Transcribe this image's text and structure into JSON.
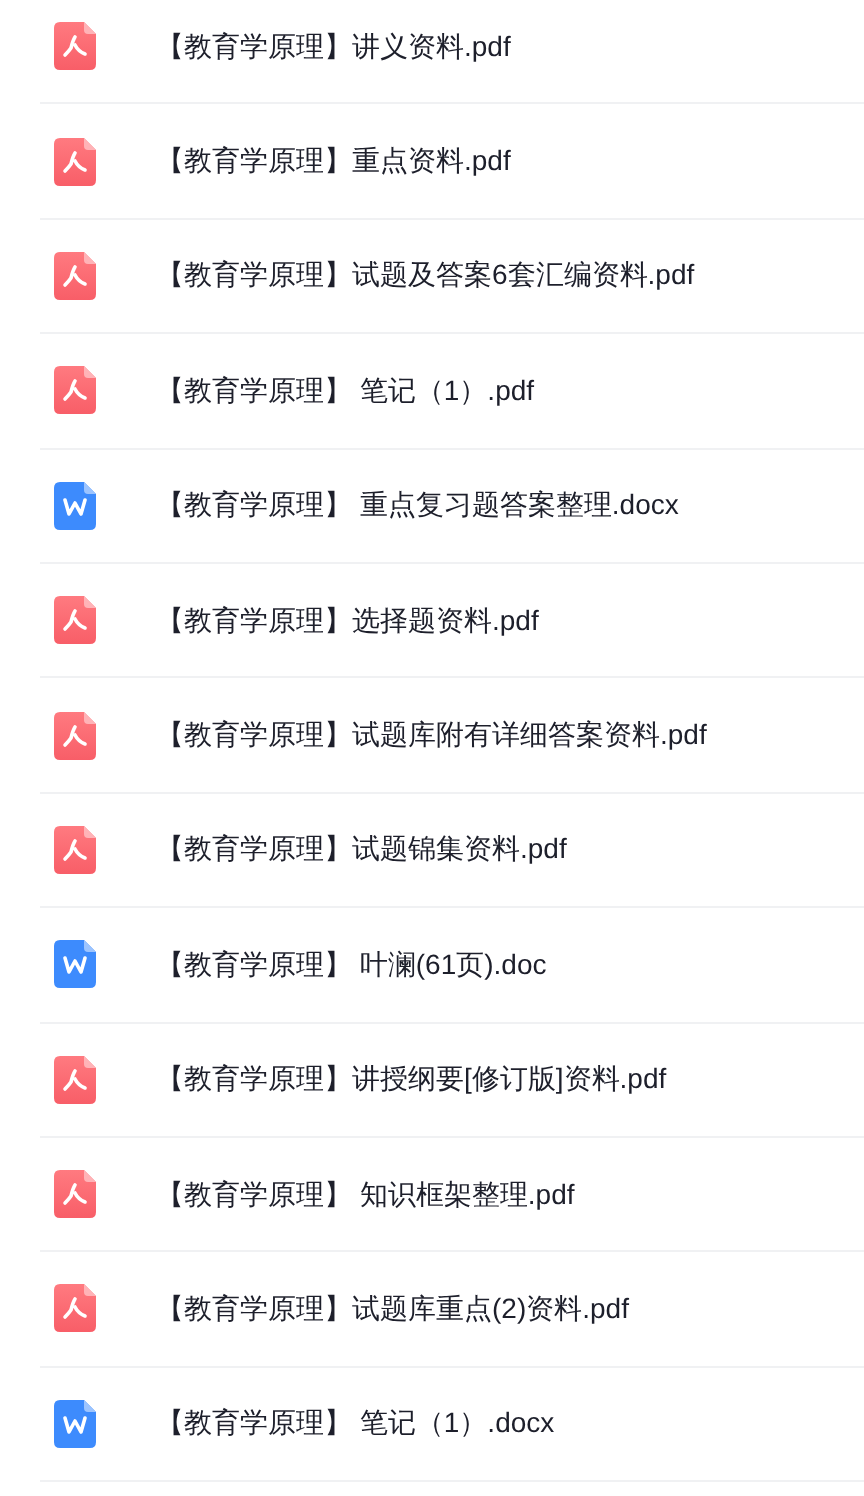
{
  "files": [
    {
      "kind": "pdf",
      "name": "【教育学原理】讲义资料.pdf"
    },
    {
      "kind": "pdf",
      "name": "【教育学原理】重点资料.pdf"
    },
    {
      "kind": "pdf",
      "name": "【教育学原理】试题及答案6套汇编资料.pdf"
    },
    {
      "kind": "pdf",
      "name": "【教育学原理】 笔记（1）.pdf"
    },
    {
      "kind": "word",
      "name": "【教育学原理】 重点复习题答案整理.docx"
    },
    {
      "kind": "pdf",
      "name": "【教育学原理】选择题资料.pdf"
    },
    {
      "kind": "pdf",
      "name": "【教育学原理】试题库附有详细答案资料.pdf"
    },
    {
      "kind": "pdf",
      "name": "【教育学原理】试题锦集资料.pdf"
    },
    {
      "kind": "word",
      "name": "【教育学原理】 叶澜(61页).doc"
    },
    {
      "kind": "pdf",
      "name": "【教育学原理】讲授纲要[修订版]资料.pdf"
    },
    {
      "kind": "pdf",
      "name": "【教育学原理】 知识框架整理.pdf"
    },
    {
      "kind": "pdf",
      "name": "【教育学原理】试题库重点(2)资料.pdf"
    },
    {
      "kind": "word",
      "name": "【教育学原理】 笔记（1）.docx"
    }
  ]
}
